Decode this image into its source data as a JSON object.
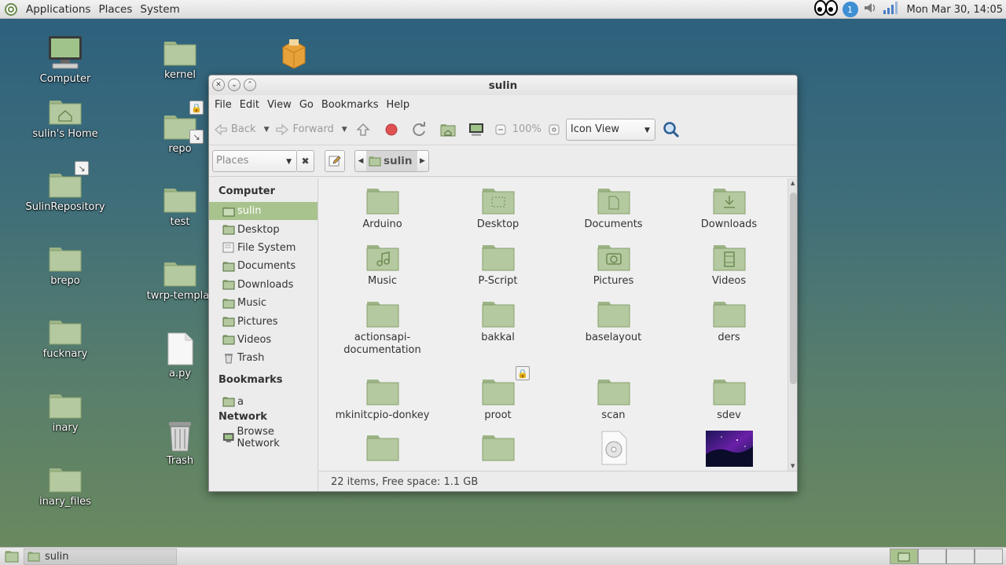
{
  "top_panel": {
    "menus": [
      "Applications",
      "Places",
      "System"
    ],
    "clock": "Mon Mar 30, 14:05",
    "notification_count": "1"
  },
  "desktop": {
    "icons": [
      {
        "label": "Computer",
        "type": "computer"
      },
      {
        "label": "sulin's Home",
        "type": "home"
      },
      {
        "label": "SulinRepository",
        "type": "folder-link"
      },
      {
        "label": "brepo",
        "type": "folder"
      },
      {
        "label": "fucknary",
        "type": "folder"
      },
      {
        "label": "inary",
        "type": "folder"
      },
      {
        "label": "inary_files",
        "type": "folder"
      },
      {
        "label": "kernel",
        "type": "folder"
      },
      {
        "label": "repo",
        "type": "folder-locked-link"
      },
      {
        "label": "test",
        "type": "folder"
      },
      {
        "label": "twrp-templat",
        "type": "folder"
      },
      {
        "label": "a.py",
        "type": "file"
      },
      {
        "label": "Trash",
        "type": "trash"
      },
      {
        "label": "",
        "type": "package"
      }
    ]
  },
  "window": {
    "title": "sulin",
    "menu": [
      "File",
      "Edit",
      "View",
      "Go",
      "Bookmarks",
      "Help"
    ],
    "toolbar": {
      "back": "Back",
      "forward": "Forward",
      "zoom": "100%",
      "view_mode": "Icon View"
    },
    "location": {
      "places_placeholder": "Places",
      "current": "sulin"
    },
    "sidebar": {
      "computer_header": "Computer",
      "computer_items": [
        "sulin",
        "Desktop",
        "File System",
        "Documents",
        "Downloads",
        "Music",
        "Pictures",
        "Videos",
        "Trash"
      ],
      "bookmarks_header": "Bookmarks",
      "bookmark_items": [
        "a"
      ],
      "network_header": "Network",
      "network_items": [
        "Browse Network"
      ]
    },
    "files": [
      {
        "name": "Arduino",
        "emblem": ""
      },
      {
        "name": "Desktop",
        "emblem": "desktop"
      },
      {
        "name": "Documents",
        "emblem": "documents"
      },
      {
        "name": "Downloads",
        "emblem": "downloads"
      },
      {
        "name": "Music",
        "emblem": "music"
      },
      {
        "name": "P-Script",
        "emblem": ""
      },
      {
        "name": "Pictures",
        "emblem": "pictures"
      },
      {
        "name": "Videos",
        "emblem": "videos"
      },
      {
        "name": "actionsapi-documentation",
        "emblem": ""
      },
      {
        "name": "bakkal",
        "emblem": ""
      },
      {
        "name": "baselayout",
        "emblem": ""
      },
      {
        "name": "ders",
        "emblem": ""
      },
      {
        "name": "mkinitcpio-donkey",
        "emblem": ""
      },
      {
        "name": "proot",
        "emblem": "locked"
      },
      {
        "name": "scan",
        "emblem": ""
      },
      {
        "name": "sdev",
        "emblem": ""
      }
    ],
    "status": "22 items, Free space: 1.1 GB"
  },
  "bottom_panel": {
    "task_label": "sulin"
  },
  "colors": {
    "accent": "#a8c38d",
    "folder_body": "#b4c9a0",
    "folder_tab": "#9db486"
  }
}
